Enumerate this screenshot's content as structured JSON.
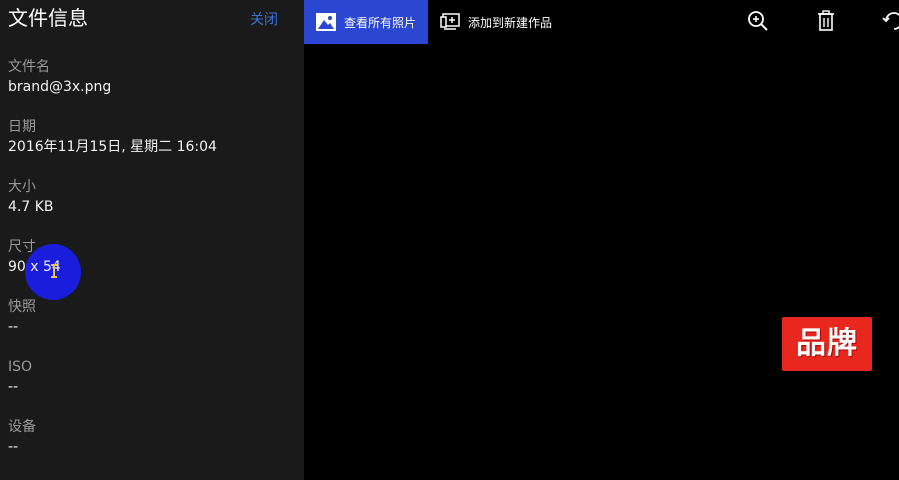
{
  "info_panel": {
    "title": "文件信息",
    "close_label": "关闭",
    "fields": [
      {
        "label": "文件名",
        "value": "brand@3x.png"
      },
      {
        "label": "日期",
        "value": "2016年11月15日, 星期二 16:04"
      },
      {
        "label": "大小",
        "value": "4.7 KB"
      },
      {
        "label": "尺寸",
        "value": "90 x 54"
      },
      {
        "label": "快照",
        "value": "--"
      },
      {
        "label": "ISO",
        "value": "--"
      },
      {
        "label": "设备",
        "value": "--"
      }
    ]
  },
  "toolbar": {
    "view_all_photos_label": "查看所有照片",
    "view_all_photos_icon": "photo-landscape-icon",
    "add_to_creation_label": "添加到新建作品",
    "add_to_creation_icon": "add-to-creation-icon",
    "zoom_icon": "zoom-in-icon",
    "delete_icon": "trash-icon",
    "rotate_icon": "rotate-icon"
  },
  "viewer": {
    "image_text": "品牌"
  },
  "colors": {
    "panel_bg": "#1a1a1a",
    "accent_blue": "#2b46d0",
    "link_blue": "#3b6fd6",
    "brand_red": "#e8281e",
    "cursor_highlight": "#1a1ee6"
  }
}
